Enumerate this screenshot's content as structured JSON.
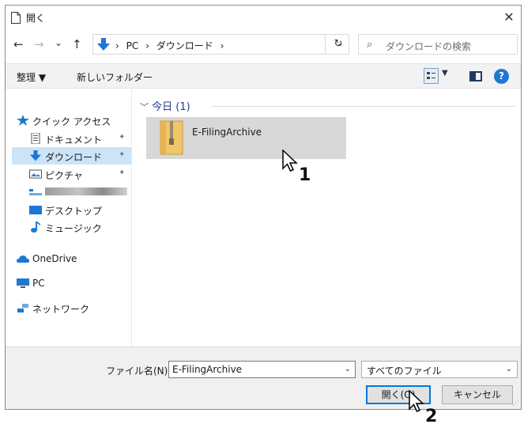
{
  "window": {
    "title": "開く",
    "close": "✕"
  },
  "address": {
    "back": "←",
    "forward": "→",
    "recent": "⌄",
    "up": "↑",
    "crumbs": [
      "PC",
      "ダウンロード"
    ],
    "sep": "›",
    "dropdown": "⌄",
    "refresh": "↻",
    "search_placeholder": "ダウンロードの検索",
    "search_glyph": "⌕"
  },
  "toolbar": {
    "organize": "整理 ▼",
    "new_folder": "新しいフォルダー",
    "view_dropdown": "▼",
    "help": "?"
  },
  "nav": {
    "quick_access": "クイック アクセス",
    "documents": "ドキュメント",
    "downloads": "ダウンロード",
    "pictures": "ピクチャ",
    "desktop": "デスクトップ",
    "music": "ミュージック",
    "onedrive": "OneDrive",
    "pc": "PC",
    "network": "ネットワーク",
    "pin": "📌"
  },
  "content": {
    "group_header": "今日 (1)",
    "files": [
      {
        "name": "E-FilingArchive"
      }
    ]
  },
  "bottom": {
    "filename_label": "ファイル名(N):",
    "filename_value": "E-FilingArchive",
    "filetype_value": "すべてのファイル",
    "open_button": "開く(O)",
    "cancel_button": "キャンセル",
    "dd": "⌄"
  },
  "steps": {
    "one": "1",
    "two": "2"
  },
  "colors": {
    "selection": "#cce4f7",
    "accent": "#0078d7",
    "file_selected": "#d8d8d8"
  }
}
